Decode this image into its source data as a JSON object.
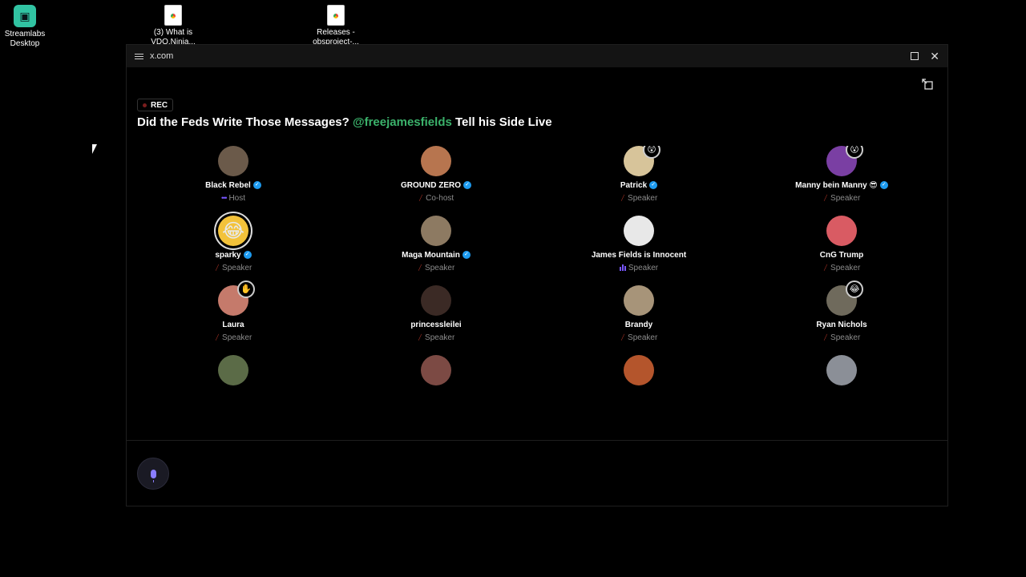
{
  "desktop": {
    "icons": [
      {
        "label_line1": "Streamlabs",
        "label_line2": "Desktop"
      },
      {
        "label_line1": "(3) What is",
        "label_line2": "VDO.Ninja..."
      },
      {
        "label_line1": "Releases -",
        "label_line2": "obsproject-..."
      }
    ]
  },
  "window": {
    "title": "x.com",
    "rec_label": "REC",
    "title_prefix": "Did the Feds Write Those Messages?",
    "title_mention": "@freejamesfields",
    "title_suffix": "Tell his Side Live"
  },
  "participants": [
    {
      "name": "Black Rebel",
      "role": "Host",
      "avatar_color": "#6b5a4a"
    },
    {
      "name": "GROUND ZERO",
      "role": "Co-host",
      "avatar_color": "#b7754f"
    },
    {
      "name": "Patrick",
      "role": "Speaker",
      "avatar_color": "#d7c49a",
      "emoji": "😲"
    },
    {
      "name": "Manny bein Manny 😎",
      "role": "Speaker",
      "avatar_color": "#7a3fa3",
      "emoji": "😮"
    },
    {
      "name": "sparky",
      "role": "Speaker",
      "avatar_color": "#f3c23a",
      "emoji_face": "😂"
    },
    {
      "name": "Maga Mountain",
      "role": "Speaker",
      "avatar_color": "#8d7a62"
    },
    {
      "name": "James Fields is Innocent",
      "role": "Speaker",
      "avatar_color": "#e8e8e8"
    },
    {
      "name": "CnG Trump",
      "role": "Speaker",
      "avatar_color": "#d95b63"
    },
    {
      "name": "Laura",
      "role": "Speaker",
      "avatar_color": "#c57a6b",
      "emoji": "✋"
    },
    {
      "name": "princessleilei",
      "role": "Speaker",
      "avatar_color": "#3b2a25"
    },
    {
      "name": "Brandy",
      "role": "Speaker",
      "avatar_color": "#a79479"
    },
    {
      "name": "Ryan Nichols",
      "role": "Speaker",
      "avatar_color": "#6f6a5c",
      "emoji": "😂"
    },
    {
      "name": "",
      "role": "",
      "avatar_color": "#5b6b47"
    },
    {
      "name": "",
      "role": "",
      "avatar_color": "#7c4a44"
    },
    {
      "name": "",
      "role": "",
      "avatar_color": "#b4552c"
    },
    {
      "name": "",
      "role": "",
      "avatar_color": "#8b8f97"
    }
  ],
  "icons": {
    "verified": "verified-badge-icon",
    "mic_off": "mic-off-icon",
    "mic": "microphone-icon"
  },
  "colors": {
    "mention": "#3bb26b",
    "verified": "#1d9bf0",
    "accent": "#7856ff"
  }
}
